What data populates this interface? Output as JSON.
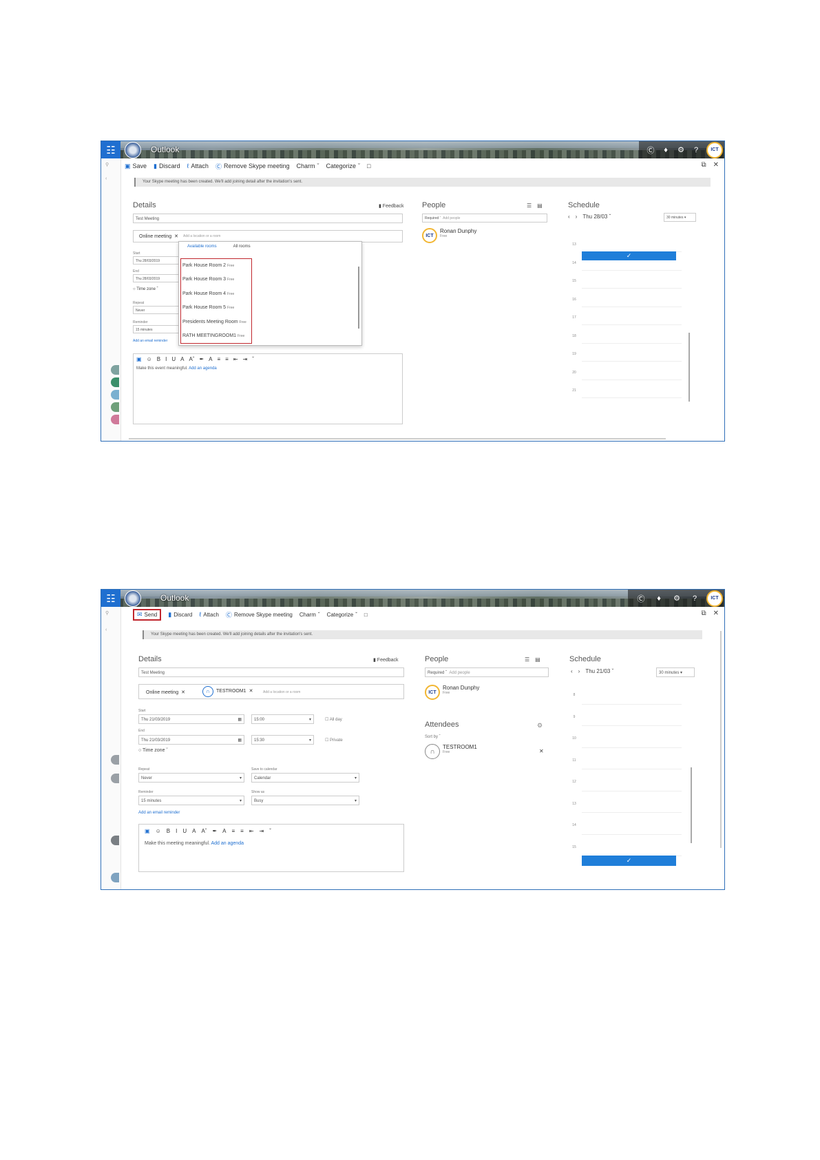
{
  "screenshot1": {
    "header": {
      "app_title": "Outlook"
    },
    "toolbar": {
      "items": [
        "Save",
        "Discard",
        "Attach",
        "Remove Skype meeting",
        "Charm",
        "Categorize"
      ]
    },
    "notice": "Your Skype meeting has been created. We'll add joining detail after the invitation's sent.",
    "details": {
      "heading": "Details",
      "feedback": "Feedback",
      "title_value": "Test Meeting",
      "location_chip": "Online meeting",
      "location_placeholder": "Add a location or a room",
      "start_label": "Start",
      "start_date": "Thu 28/03/2019",
      "end_label": "End",
      "end_date": "Thu 28/03/2019",
      "timezone": "Time zone",
      "repeat_label": "Repeat",
      "repeat_value": "Never",
      "reminder_label": "Reminder",
      "reminder_value": "15 minutes",
      "email_reminder": "Add an email reminder"
    },
    "room_dropdown": {
      "tabs": [
        "Available rooms",
        "All rooms"
      ],
      "rooms": [
        {
          "name": "Park House Room 2",
          "status": "Free"
        },
        {
          "name": "Park House Room 3",
          "status": "Free"
        },
        {
          "name": "Park House Room 4",
          "status": "Free"
        },
        {
          "name": "Park House Room 5",
          "status": "Free"
        },
        {
          "name": "Presidents Meeting Room",
          "status": "Free"
        },
        {
          "name": "RATH MEETINGROOM1",
          "status": "Free"
        }
      ]
    },
    "editor": {
      "prompt": "Make this event meaningful.",
      "agenda_link": "Add an agenda"
    },
    "people": {
      "heading": "People",
      "required": "Required",
      "add_people": "Add people",
      "person_name": "Ronan Dunphy",
      "person_status": "Free"
    },
    "schedule": {
      "heading": "Schedule",
      "date": "Thu 28/03",
      "duration": "30 minutes",
      "hours": [
        "13",
        "14",
        "15",
        "16",
        "17",
        "18",
        "19",
        "20",
        "21"
      ]
    }
  },
  "screenshot2": {
    "header": {
      "app_title": "Outlook"
    },
    "toolbar": {
      "items": [
        "Send",
        "Discard",
        "Attach",
        "Remove Skype meeting",
        "Charm",
        "Categorize"
      ]
    },
    "notice": "Your Skype meeting has been created. We'll add joining details after the invitation's sent.",
    "details": {
      "heading": "Details",
      "feedback": "Feedback",
      "title_value": "Test Meeting",
      "location_chip": "Online meeting",
      "room_chip": "TESTROOM1",
      "location_placeholder": "Add a location or a room",
      "start_label": "Start",
      "start_date": "Thu 21/03/2019",
      "start_time": "15:00",
      "allday": "All day",
      "end_label": "End",
      "end_date": "Thu 21/03/2019",
      "end_time": "15:30",
      "private": "Private",
      "timezone": "Time zone",
      "repeat_label": "Repeat",
      "repeat_value": "Never",
      "save_label": "Save to calendar",
      "save_value": "Calendar",
      "reminder_label": "Reminder",
      "reminder_value": "15 minutes",
      "showas_label": "Show as",
      "showas_value": "Busy",
      "email_reminder": "Add an email reminder"
    },
    "editor": {
      "prompt": "Make this meeting meaningful.",
      "agenda_link": "Add an agenda"
    },
    "people": {
      "heading": "People",
      "required": "Required",
      "add_people": "Add people",
      "person_name": "Ronan Dunphy",
      "person_status": "Free",
      "attendees_heading": "Attendees",
      "sort_by": "Sort by",
      "attendee_name": "TESTROOM1",
      "attendee_status": "Free"
    },
    "schedule": {
      "heading": "Schedule",
      "date": "Thu 21/03",
      "duration": "30 minutes",
      "hours": [
        "8",
        "9",
        "10",
        "11",
        "12",
        "13",
        "14",
        "15"
      ]
    }
  },
  "colors": {
    "accent": "#1f6fd0",
    "highlight": "#c0262d",
    "slot": "#1f7ed9"
  }
}
